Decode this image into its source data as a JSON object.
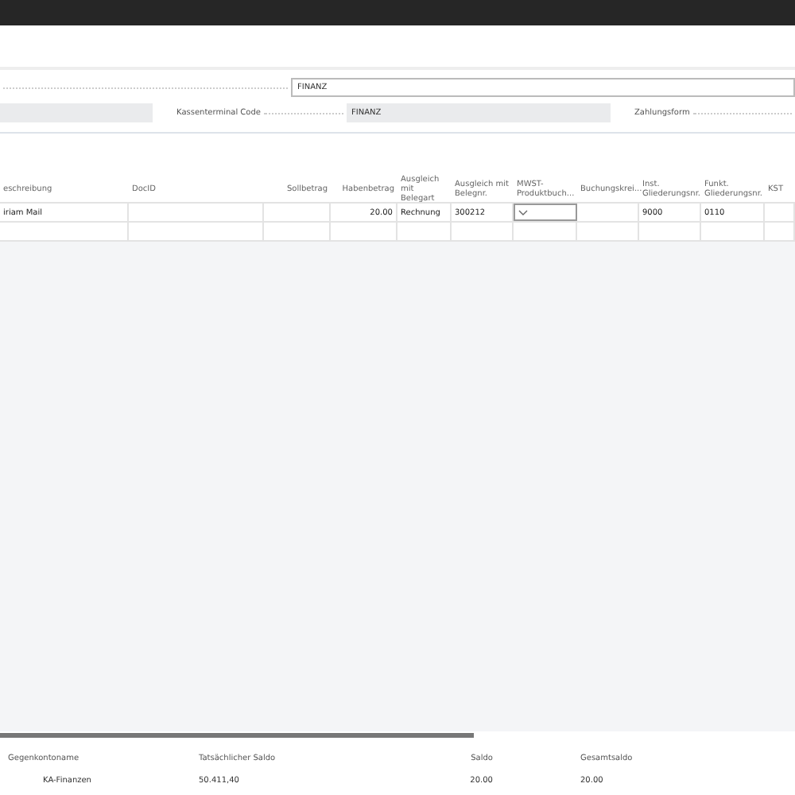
{
  "form": {
    "top_field": {
      "value": "FINANZ"
    },
    "terminal": {
      "label": "Kassenterminal Code",
      "value": "FINANZ"
    },
    "payment": {
      "label": "Zahlungsform"
    }
  },
  "table": {
    "columns": [
      {
        "label": "eschreibung",
        "kind": "text"
      },
      {
        "label": "DocID",
        "kind": "text"
      },
      {
        "label": "Sollbetrag",
        "kind": "amount"
      },
      {
        "label": "Habenbetrag",
        "kind": "amount"
      },
      {
        "label": "Ausgleich mit Belegart",
        "kind": "text"
      },
      {
        "label": "Ausgleich mit Belegnr.",
        "kind": "text"
      },
      {
        "label": "MWST-Produktbuch...",
        "kind": "text"
      },
      {
        "label": "Buchungskrei...",
        "kind": "text"
      },
      {
        "label": "Inst. Gliederungsnr.",
        "kind": "text"
      },
      {
        "label": "Funkt. Gliederungsnr.",
        "kind": "text"
      },
      {
        "label": "KST",
        "kind": "text"
      }
    ],
    "rows": [
      {
        "cells": [
          {
            "kind": "text",
            "value": "iriam Mail"
          },
          {
            "kind": "text"
          },
          {
            "kind": "amount"
          },
          {
            "kind": "amount",
            "value": "20.00"
          },
          {
            "kind": "text",
            "value": "Rechnung"
          },
          {
            "kind": "text",
            "value": "300212"
          },
          {
            "kind": "dropdown"
          },
          {
            "kind": "text"
          },
          {
            "kind": "text",
            "value": "9000"
          },
          {
            "kind": "text",
            "value": "0110"
          },
          {
            "kind": "text"
          }
        ]
      },
      {
        "cells": [
          {
            "kind": "text"
          },
          {
            "kind": "text"
          },
          {
            "kind": "amount"
          },
          {
            "kind": "amount"
          },
          {
            "kind": "text"
          },
          {
            "kind": "text"
          },
          {
            "kind": "text"
          },
          {
            "kind": "text"
          },
          {
            "kind": "text"
          },
          {
            "kind": "text"
          },
          {
            "kind": "text"
          }
        ]
      }
    ]
  },
  "footer": {
    "columns": [
      {
        "label": "Gegenkontoname",
        "value": "KA-Finanzen"
      },
      {
        "label": "Tatsächlicher Saldo",
        "value": "50.411,40"
      },
      {
        "label": "Saldo",
        "value": "20.00"
      },
      {
        "label": "Gesamtsaldo",
        "value": "20.00"
      }
    ]
  }
}
